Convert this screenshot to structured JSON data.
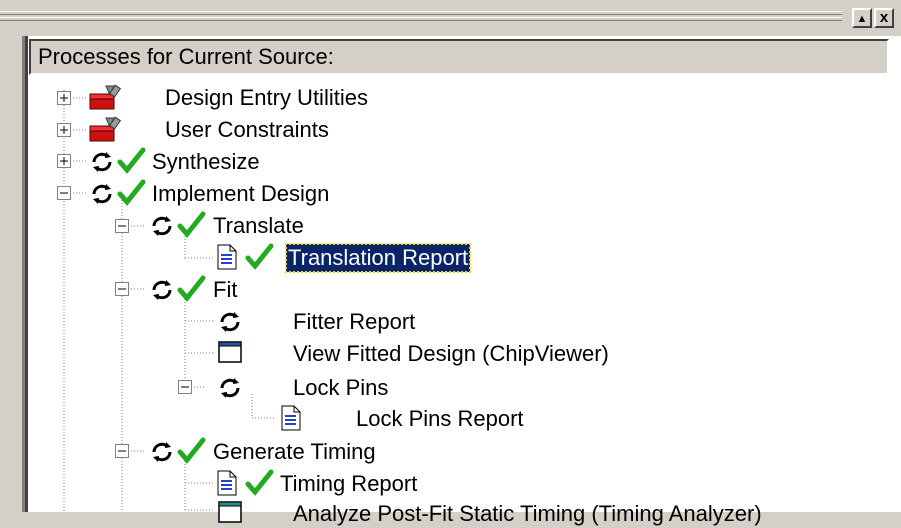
{
  "window": {
    "restore_glyph": "▲",
    "close_glyph": "x"
  },
  "panel": {
    "header": "Processes for Current Source:"
  },
  "tree": {
    "items": [
      {
        "label": "Design Entry Utilities",
        "icon": "toolbox-icon",
        "status": ""
      },
      {
        "label": "User Constraints",
        "icon": "toolbox-icon",
        "status": ""
      },
      {
        "label": "Synthesize",
        "icon": "process-icon",
        "status": "check-icon"
      },
      {
        "label": "Implement Design",
        "icon": "process-icon",
        "status": "check-icon"
      },
      {
        "label": "Translate",
        "icon": "process-icon",
        "status": "check-icon"
      },
      {
        "label": "Translation Report",
        "icon": "report-icon",
        "status": "check-icon",
        "selected": true
      },
      {
        "label": "Fit",
        "icon": "process-icon",
        "status": "check-icon"
      },
      {
        "label": "Fitter Report",
        "icon": "process-icon",
        "status": ""
      },
      {
        "label": "View Fitted Design (ChipViewer)",
        "icon": "window-icon",
        "status": ""
      },
      {
        "label": "Lock Pins",
        "icon": "process-icon",
        "status": ""
      },
      {
        "label": "Lock Pins Report",
        "icon": "report-icon",
        "status": ""
      },
      {
        "label": "Generate Timing",
        "icon": "process-icon",
        "status": "check-icon"
      },
      {
        "label": "Timing Report",
        "icon": "report-icon",
        "status": "check-icon"
      },
      {
        "label": "Analyze Post-Fit Static Timing (Timing Analyzer)",
        "icon": "window-icon",
        "status": ""
      }
    ]
  },
  "colors": {
    "selection": "#0a246a",
    "check": "#22aa22",
    "toolbox": "#cc1111"
  }
}
